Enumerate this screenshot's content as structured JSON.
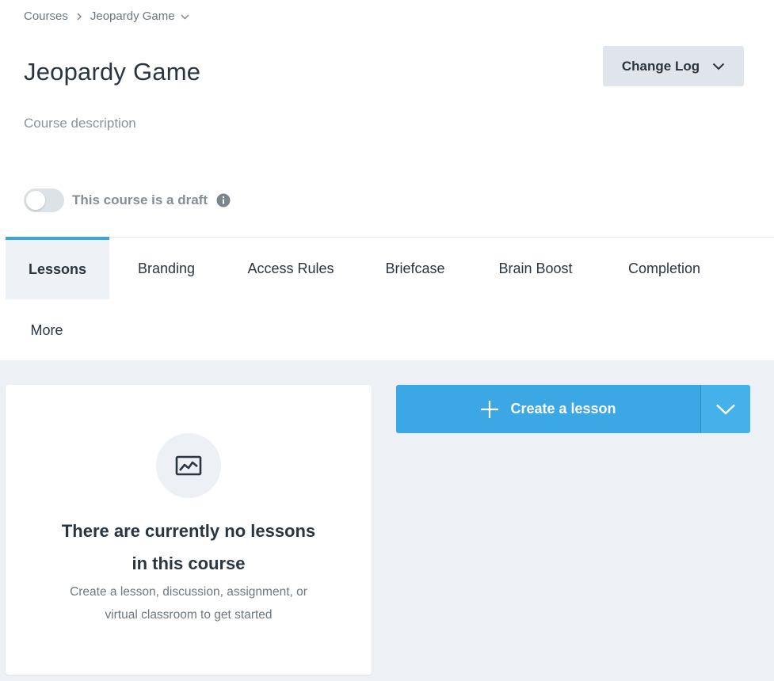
{
  "breadcrumb": {
    "root": "Courses",
    "current": "Jeopardy Game"
  },
  "course": {
    "title": "Jeopardy Game",
    "description_placeholder": "Course description"
  },
  "header": {
    "change_log_label": "Change Log"
  },
  "draft": {
    "label": "This course is a draft",
    "enabled": false
  },
  "tabs": [
    {
      "label": "Lessons",
      "active": true
    },
    {
      "label": "Branding",
      "active": false
    },
    {
      "label": "Access Rules",
      "active": false
    },
    {
      "label": "Briefcase",
      "active": false
    },
    {
      "label": "Brain Boost",
      "active": false
    },
    {
      "label": "Completion",
      "active": false
    },
    {
      "label": "More",
      "active": false
    }
  ],
  "empty_state": {
    "icon": "chart-image-icon",
    "title_line1": "There are currently no lessons",
    "title_line2": "in this course",
    "subtitle_line1": "Create a lesson, discussion, assignment, or",
    "subtitle_line2": "virtual classroom to get started"
  },
  "actions": {
    "create_lesson_label": "Create a lesson"
  },
  "colors": {
    "accent": "#3ba7e4",
    "accent_light": "#45b1ea",
    "tab_active_bg": "#eef1f5",
    "main_bg": "#edf0f4",
    "secondary_button_bg": "#dfe5ea"
  }
}
